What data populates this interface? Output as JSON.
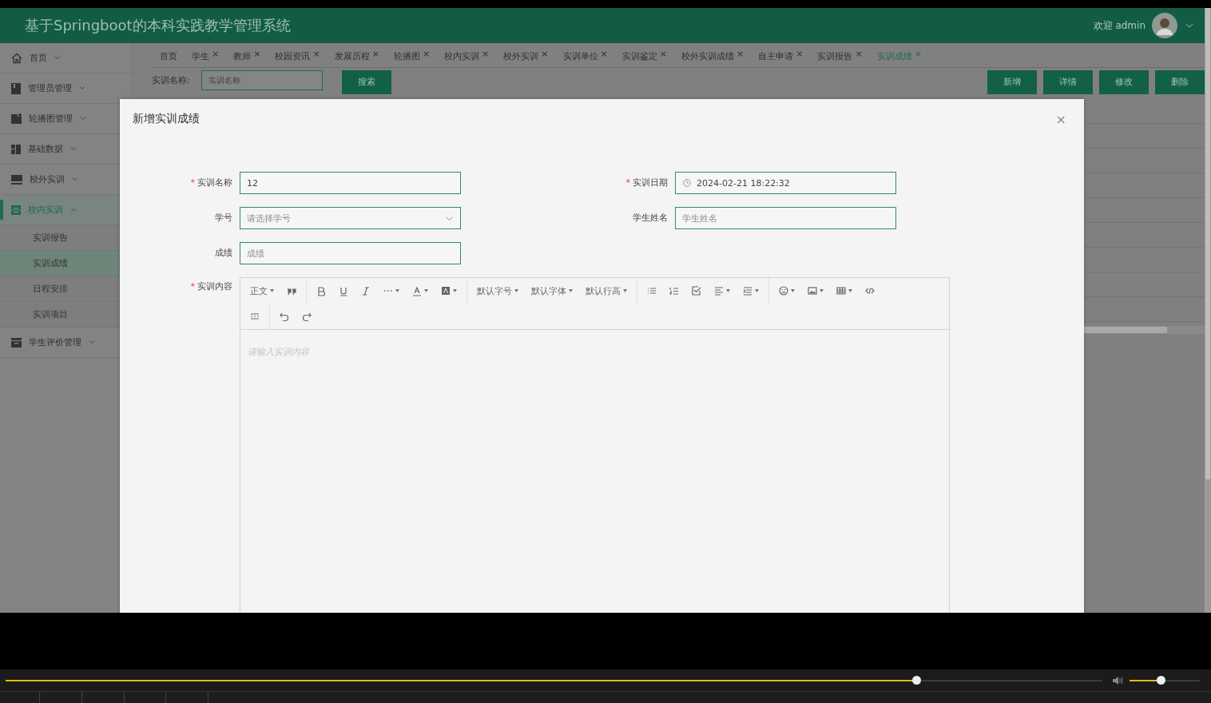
{
  "header": {
    "title": "基于Springboot的本科实践教学管理系统",
    "welcome": "欢迎 admin"
  },
  "sidebar": [
    {
      "label": "首页",
      "expanded": false,
      "selected": false
    },
    {
      "label": "管理员管理",
      "expanded": false,
      "selected": false
    },
    {
      "label": "轮播图管理",
      "expanded": false,
      "selected": false
    },
    {
      "label": "基础数据",
      "expanded": false,
      "selected": false
    },
    {
      "label": "校外实训",
      "expanded": false,
      "selected": false
    },
    {
      "label": "校内实训",
      "expanded": true,
      "selected": true,
      "children": [
        {
          "label": "实训报告",
          "selected": false
        },
        {
          "label": "实训成绩",
          "selected": true
        },
        {
          "label": "日程安排",
          "selected": false
        },
        {
          "label": "实训项目",
          "selected": false
        }
      ]
    },
    {
      "label": "学生评价管理",
      "expanded": false,
      "selected": false
    }
  ],
  "tabs": [
    {
      "label": "首页",
      "selected": false
    },
    {
      "label": "学生",
      "close": "×",
      "selected": false
    },
    {
      "label": "教师",
      "close": "×",
      "selected": false
    },
    {
      "label": "校园资讯",
      "close": "×",
      "selected": false
    },
    {
      "label": "发展历程",
      "close": "×",
      "selected": false
    },
    {
      "label": "轮播图",
      "close": "×",
      "selected": false
    },
    {
      "label": "校内实训",
      "close": "×",
      "selected": false
    },
    {
      "label": "校外实训",
      "close": "×",
      "selected": false
    },
    {
      "label": "实训单位",
      "close": "×",
      "selected": false
    },
    {
      "label": "实训鉴定",
      "close": "×",
      "selected": false
    },
    {
      "label": "校外实训成绩",
      "close": "×",
      "selected": false
    },
    {
      "label": "自主申请",
      "close": "×",
      "selected": false
    },
    {
      "label": "实训报告",
      "close": "×",
      "selected": false
    },
    {
      "label": "实训成绩",
      "close": "×",
      "selected": true
    }
  ],
  "search": {
    "label": "实训名称:",
    "placeholder": "实训名称",
    "button": "搜索"
  },
  "actions": [
    "新增",
    "详情",
    "修改",
    "删除"
  ],
  "modal": {
    "title": "新增实训成绩",
    "close": "×",
    "required_mark": "*",
    "rows": [
      [
        {
          "label": "实训名称",
          "required": true,
          "kind": "text",
          "value": "12"
        },
        {
          "label": "实训日期",
          "required": true,
          "kind": "date",
          "value": "2024-02-21 18:22:32"
        }
      ],
      [
        {
          "label": "学号",
          "required": false,
          "kind": "select",
          "placeholder": "请选择学号"
        },
        {
          "label": "学生姓名",
          "required": false,
          "kind": "text",
          "placeholder": "学生姓名"
        }
      ],
      [
        {
          "label": "成绩",
          "required": false,
          "kind": "text",
          "placeholder": "成绩"
        }
      ]
    ],
    "editor": {
      "label": "实训内容",
      "required": true,
      "placeholder": "请输入实训内容",
      "toolbar": [
        [
          [
            {
              "kind": "text",
              "label": "正文",
              "caret": true
            },
            {
              "kind": "icon",
              "caret": false
            }
          ],
          [
            {
              "kind": "icon",
              "caret": false
            },
            {
              "kind": "icon",
              "caret": false
            },
            {
              "kind": "icon",
              "caret": false
            },
            {
              "kind": "icon",
              "caret": true
            },
            {
              "kind": "icon",
              "caret": true
            },
            {
              "kind": "icon",
              "caret": true
            }
          ],
          [
            {
              "kind": "text",
              "label": "默认字号",
              "caret": true
            },
            {
              "kind": "text",
              "label": "默认字体",
              "caret": true
            },
            {
              "kind": "text",
              "label": "默认行高",
              "caret": true
            }
          ],
          [
            {
              "kind": "icon",
              "caret": false
            },
            {
              "kind": "icon",
              "caret": false
            },
            {
              "kind": "icon",
              "caret": false
            },
            {
              "kind": "icon",
              "caret": true
            },
            {
              "kind": "icon",
              "caret": true
            }
          ],
          [
            {
              "kind": "icon",
              "caret": true
            },
            {
              "kind": "icon",
              "caret": true
            },
            {
              "kind": "icon",
              "caret": true
            },
            {
              "kind": "icon",
              "caret": false
            }
          ]
        ],
        [
          [
            {
              "kind": "icon",
              "caret": false
            }
          ],
          [
            {
              "kind": "icon",
              "caret": false
            },
            {
              "kind": "icon",
              "caret": false
            }
          ]
        ]
      ]
    }
  },
  "player": {
    "seek": {
      "level": 0.83
    },
    "volume": {
      "level": 0.44
    }
  }
}
